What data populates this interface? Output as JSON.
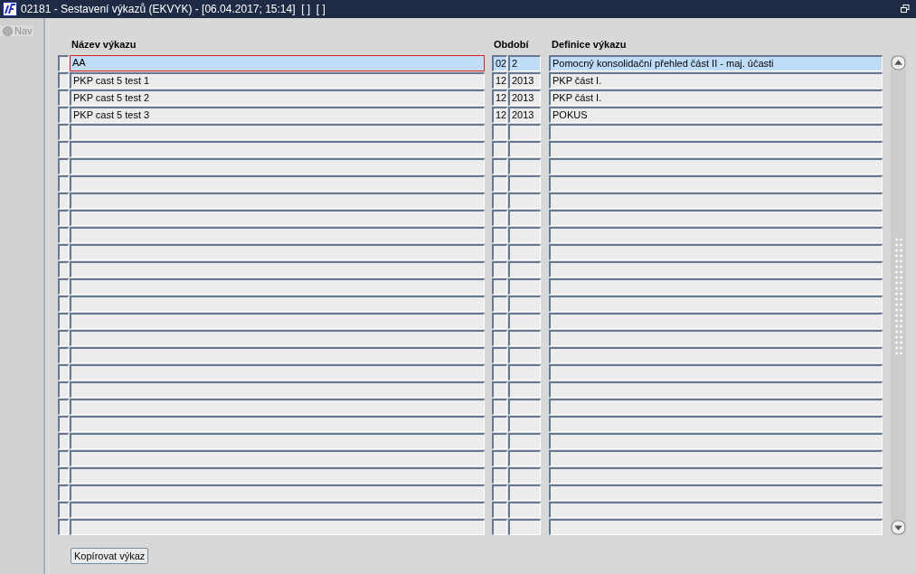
{
  "window": {
    "title": "02181 - Sestavení výkazů (EKVYK) - [06.04.2017; 15:14]  [ ]  [ ]"
  },
  "sidebar": {
    "nav_label": "Nav",
    "disabled": true
  },
  "table": {
    "columns": [
      "Název výkazu",
      "Období",
      "Definice výkazu"
    ],
    "rows": [
      {
        "selected": true,
        "name": "AA",
        "month": "02",
        "year": "2",
        "definition": "Pomocný konsolidační přehled část II - maj. účasti"
      },
      {
        "selected": false,
        "name": "PKP cast 5 test 1",
        "month": "12",
        "year": "2013",
        "definition": "PKP část I."
      },
      {
        "selected": false,
        "name": "PKP cast 5 test 2",
        "month": "12",
        "year": "2013",
        "definition": "PKP část I."
      },
      {
        "selected": false,
        "name": "PKP cast 5 test 3",
        "month": "12",
        "year": "2013",
        "definition": "POKUS"
      },
      {
        "selected": false
      },
      {
        "selected": false
      },
      {
        "selected": false
      },
      {
        "selected": false
      },
      {
        "selected": false
      },
      {
        "selected": false
      },
      {
        "selected": false
      },
      {
        "selected": false
      },
      {
        "selected": false
      },
      {
        "selected": false
      },
      {
        "selected": false
      },
      {
        "selected": false
      },
      {
        "selected": false
      },
      {
        "selected": false
      },
      {
        "selected": false
      },
      {
        "selected": false
      },
      {
        "selected": false
      },
      {
        "selected": false
      },
      {
        "selected": false
      },
      {
        "selected": false
      },
      {
        "selected": false
      },
      {
        "selected": false
      },
      {
        "selected": false
      },
      {
        "selected": false
      }
    ]
  },
  "buttons": [
    "Kopírovat výkaz"
  ]
}
